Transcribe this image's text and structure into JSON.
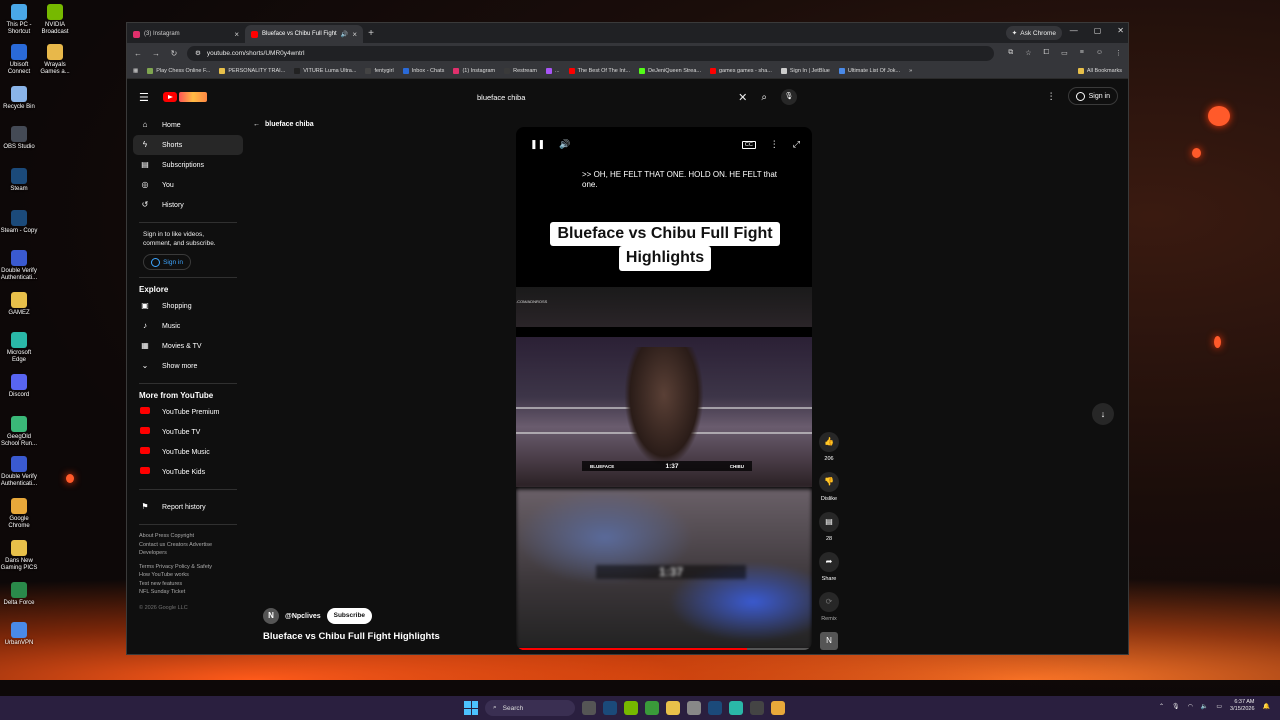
{
  "desktop": {
    "icons": [
      {
        "label": "This PC - Shortcut",
        "color": "#4aa8e8"
      },
      {
        "label": "NVIDIA Broadcast",
        "color": "#76b900"
      },
      {
        "label": "Ubisoft Connect",
        "color": "#2a6ad8"
      },
      {
        "label": "Wrayals Games a...",
        "color": "#e8b84a"
      },
      {
        "label": "Recycle Bin",
        "color": "#8ab4e8"
      },
      {
        "label": "OBS Studio",
        "color": "#444a55"
      },
      {
        "label": "Steam",
        "color": "#1b4a7a"
      },
      {
        "label": "Steam - Copy",
        "color": "#1b4a7a"
      },
      {
        "label": "Double Verify Authenticati...",
        "color": "#3a5ad0"
      },
      {
        "label": "GAMEZ",
        "color": "#e8c04a"
      },
      {
        "label": "Microsoft Edge",
        "color": "#2ab8a8"
      },
      {
        "label": "Discord",
        "color": "#5865f2"
      },
      {
        "label": "GeegOld School Run...",
        "color": "#3ab878"
      },
      {
        "label": "Double Verify Authenticati...",
        "color": "#3a5ad0"
      },
      {
        "label": "Google Chrome",
        "color": "#e8a83a"
      },
      {
        "label": "Dans New Gaming PICS",
        "color": "#e8c04a"
      },
      {
        "label": "Delta Force",
        "color": "#2a8a4a"
      },
      {
        "label": "UrbanVPN",
        "color": "#4a8ae8"
      }
    ]
  },
  "browser": {
    "tabs": [
      {
        "title": "(3) Instagram",
        "icon": "instagram-icon",
        "color": "#e1306c"
      },
      {
        "title": "Blueface vs Chibu Full Fight",
        "icon": "youtube-icon",
        "color": "#ff0000"
      }
    ],
    "ask_chrome": "Ask Chrome",
    "url": "youtube.com/shorts/UMR0y4wntrI",
    "bookmarks": [
      {
        "label": "Play Chess Online F...",
        "color": "#7fa650"
      },
      {
        "label": "PERSONALITY TRAI...",
        "color": "#e8c04a"
      },
      {
        "label": "VITURE Luma Ultra...",
        "color": "#222222"
      },
      {
        "label": "fentygirl",
        "color": "#444444"
      },
      {
        "label": "Inbox - Chats",
        "color": "#2a6ad8"
      },
      {
        "label": "(1) Instagram",
        "color": "#e1306c"
      },
      {
        "label": "Restream",
        "color": "#3a3a3a"
      },
      {
        "label": "...",
        "color": "#a855f7"
      },
      {
        "label": "The Best Of The Int...",
        "color": "#ff0000"
      },
      {
        "label": "DeJeniQueen Strea...",
        "color": "#53fc18"
      },
      {
        "label": "games games - sha...",
        "color": "#ff0000"
      },
      {
        "label": "Sign In | JetBlue",
        "color": "#cccccc"
      },
      {
        "label": "Ultimate List Of Jok...",
        "color": "#4a8ae8"
      }
    ],
    "all_bookmarks": "All Bookmarks"
  },
  "youtube": {
    "search_query": "blueface chiba",
    "sign_in": "Sign in",
    "sidebar": {
      "main": [
        {
          "label": "Home",
          "icon": "home-icon",
          "glyph": "⌂"
        },
        {
          "label": "Shorts",
          "icon": "shorts-icon",
          "glyph": "ϟ",
          "active": true
        },
        {
          "label": "Subscriptions",
          "icon": "subscriptions-icon",
          "glyph": "▤"
        },
        {
          "label": "You",
          "icon": "you-icon",
          "glyph": "◎"
        },
        {
          "label": "History",
          "icon": "history-icon",
          "glyph": "↺"
        }
      ],
      "signin_note": "Sign in to like videos, comment, and subscribe.",
      "signin_button": "Sign in",
      "explore_heading": "Explore",
      "explore": [
        {
          "label": "Shopping",
          "icon": "shopping-icon",
          "glyph": "▣"
        },
        {
          "label": "Music",
          "icon": "music-icon",
          "glyph": "♪"
        },
        {
          "label": "Movies & TV",
          "icon": "movies-icon",
          "glyph": "▦"
        },
        {
          "label": "Show more",
          "icon": "chevron-down-icon",
          "glyph": "⌄"
        }
      ],
      "more_heading": "More from YouTube",
      "more": [
        {
          "label": "YouTube Premium"
        },
        {
          "label": "YouTube TV"
        },
        {
          "label": "YouTube Music"
        },
        {
          "label": "YouTube Kids"
        }
      ],
      "report_history": "Report history",
      "footer_1": "About  Press  Copyright",
      "footer_2": "Contact us  Creators  Advertise",
      "footer_3": "Developers",
      "footer_4": "Terms  Privacy  Policy & Safety",
      "footer_5": "How YouTube works",
      "footer_6": "Test new features",
      "footer_7": "NFL Sunday Ticket",
      "copyright": "© 2026 Google LLC"
    },
    "back_label": "blueface chiba",
    "short": {
      "caption": ">> OH, HE FELT THAT ONE. HOLD ON. HE FELT that one.",
      "title_line1": "Blueface vs Chibu Full Fight",
      "title_line2": "Highlights",
      "watermark": ".COM/ADNROSS",
      "score_left": "BLUEFACE",
      "score_timer": "1:37",
      "score_right": "CHIBU",
      "blur_timer": "1:37",
      "progress": 0.78
    },
    "channel": {
      "initial": "N",
      "handle": "@Npclives",
      "subscribe": "Subscribe"
    },
    "video_title": "Blueface vs Chibu Full Fight Highlights",
    "actions": {
      "likes": "206",
      "dislike": "Dislike",
      "comments": "28",
      "share": "Share",
      "remix": "Remix",
      "avatar_initial": "N"
    }
  },
  "taskbar": {
    "search": "Search",
    "time": "6:37 AM",
    "date": "3/15/2026"
  }
}
